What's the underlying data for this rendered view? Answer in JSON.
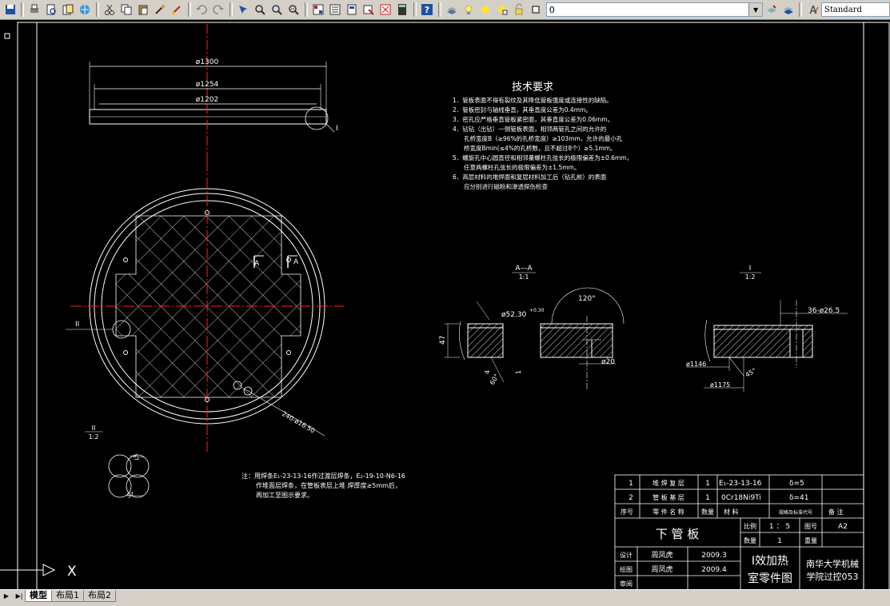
{
  "toolbar": {
    "layer_name": "0",
    "text_style": "Standard"
  },
  "drawing": {
    "dim_1300": "ø1300",
    "dim_1254": "ø1254",
    "dim_1202": "ø1202",
    "callout_i": "I",
    "callout_ii": "II",
    "detail_ii_label": "II",
    "detail_ii_scale": "1:2",
    "section_label_a": "A",
    "holes_note": "240-ø16.50",
    "dim_57a": "57",
    "dim_57b": "57",
    "weld_note_lines": [
      "注：用焊条E₁-23-13-16作过渡层焊条，E₂-19-10-N6-16",
      "作堆面层焊条，在管板表层上堆  焊厚度≥5mm后，",
      "再加工至图示要求。"
    ],
    "tech_title": "技术要求",
    "tech_lines": [
      "1．管板表面不得有裂纹及其降低管板强度或连接性的缺陷。",
      "2．管板密封与轴线垂直，其垂直度公差为0.4mm。",
      "3．密孔应严格垂直管板紧密面，其垂直度公差为0.06mm。",
      "4．钻钻（出钻）一侧管板表面，相邻两管孔之间的允许的",
      "孔桥宽度B（≥96%的孔桥宽度）≥103mm，允许的最小孔",
      "桥宽度Bmin(≤4%的孔桥数，且不超过8个）≥5.1mm。",
      "5．螺旋孔中心圆直径和相邻量螺柱孔弦长的极限偏差为±0.6mm，",
      "任意两螺柱孔弦长的极限偏差为±1.5mm。",
      "6．高层材料的堆焊面和复层材料加工后（钻孔前）的表面",
      "应分别进行磁粉和渗透探伤检查"
    ],
    "section_aa_title": "A—A",
    "section_aa_scale": "1:1",
    "aa_angle": "120°",
    "aa_dia": "ø52.30",
    "aa_tol": "+0.30",
    "aa_47": "47",
    "aa_20": "ø20",
    "aa_4": "4",
    "aa_1": "1",
    "aa_60": "60°",
    "section_i_title": "I",
    "section_i_scale": "1:2",
    "i_holes": "36-ø26.5",
    "i_1146": "ø1146",
    "i_1175": "ø1175",
    "i_45": "45°",
    "ucs_x": "X"
  },
  "title_block": {
    "bom_rows": [
      {
        "no": "1",
        "name": "堆 焊 复 层",
        "qty": "1",
        "material": "E₁-23-13-16",
        "note": "δ=5"
      },
      {
        "no": "2",
        "name": "管 板 基 层",
        "qty": "1",
        "material": "0Cr18Ni9Ti",
        "note": "δ=41"
      }
    ],
    "bom_header": {
      "no": "序号",
      "name": "零 件 名 称",
      "qty": "数量",
      "material": "材        料",
      "std": "规格及标准代号",
      "note": "备    注"
    },
    "part_name": "下  管  板",
    "scale_label": "比例",
    "scale_value": "1 ： 5",
    "drawing_no_label": "图号",
    "drawing_no": "A2",
    "qty_label": "数量",
    "qty_value": "1",
    "weight_label": "重量",
    "design_label": "设计",
    "design_name": "周凤虎",
    "design_date": "2009.3",
    "draw_label": "绘图",
    "draw_name": "周凤虎",
    "draw_date": "2009.4",
    "check_label": "审阅",
    "drawing_title": "Ⅰ效加热室零件图",
    "drawing_title_1": "Ⅰ效加热",
    "drawing_title_2": "室零件图",
    "org_1": "南华大学机械",
    "org_2": "学院过控053"
  },
  "status": {
    "tabs": [
      "模型",
      "布局1",
      "布局2"
    ],
    "active_tab": "模型"
  },
  "colors": {
    "background": "#000000",
    "centerline": "#ff0000",
    "geometry": "#ffffff",
    "toolbar": "#d4d0c8"
  }
}
